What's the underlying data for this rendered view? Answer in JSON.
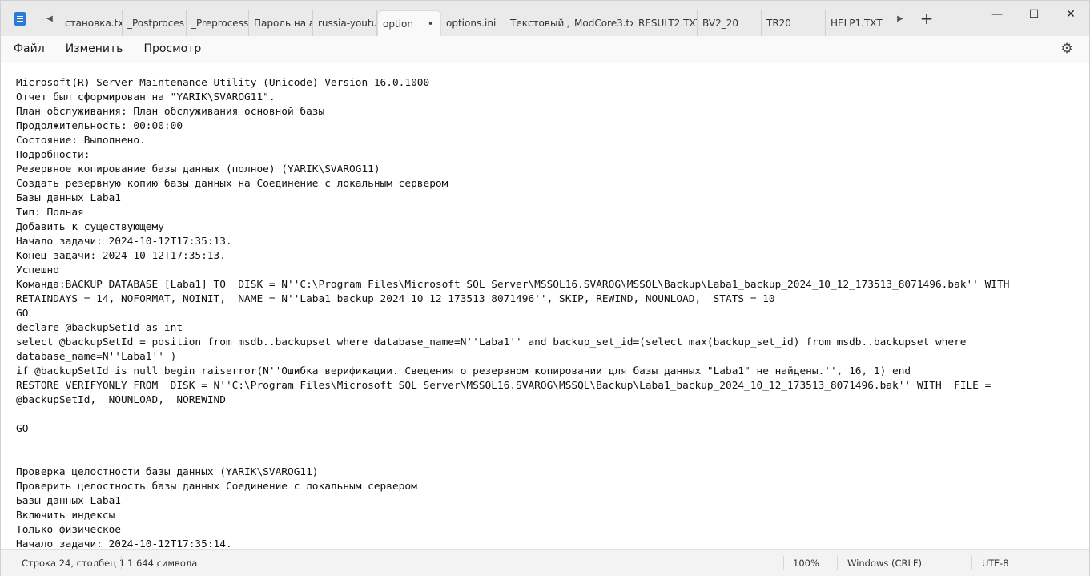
{
  "tabs": {
    "items": [
      {
        "label": "становка.tx"
      },
      {
        "label": "_Postproces"
      },
      {
        "label": "_Preprocess"
      },
      {
        "label": "Пароль на а"
      },
      {
        "label": "russia-youtu"
      },
      {
        "label": "option",
        "active": true,
        "modified_marker": "•"
      },
      {
        "label": "options.ini"
      },
      {
        "label": "Текстовый д"
      },
      {
        "label": "ModCore3.tx"
      },
      {
        "label": "RESULT2.TXT"
      },
      {
        "label": "BV2_20"
      },
      {
        "label": "TR20"
      },
      {
        "label": "HELP1.TXT"
      }
    ],
    "scroll_left": "◀",
    "scroll_right": "▶",
    "new_tab": "+"
  },
  "window_controls": {
    "minimize": "—",
    "maximize": "☐",
    "close": "✕"
  },
  "menu": {
    "file": "Файл",
    "edit": "Изменить",
    "view": "Просмотр",
    "settings_icon": "⚙"
  },
  "document": {
    "lines": [
      "Microsoft(R) Server Maintenance Utility (Unicode) Version 16.0.1000",
      "Отчет был сформирован на \"YARIK\\SVAROG11\".",
      "План обслуживания: План обслуживания основной базы",
      "Продолжительность: 00:00:00",
      "Состояние: Выполнено.",
      "Подробности:",
      "Резервное копирование базы данных (полное) (YARIK\\SVAROG11)",
      "Создать резервную копию базы данных на Соединение с локальным сервером",
      "Базы данных Laba1",
      "Тип: Полная",
      "Добавить к существующему",
      "Начало задачи: 2024-10-12T17:35:13.",
      "Конец задачи: 2024-10-12T17:35:13.",
      "Успешно",
      "Команда:BACKUP DATABASE [Laba1] TO  DISK = N''C:\\Program Files\\Microsoft SQL Server\\MSSQL16.SVAROG\\MSSQL\\Backup\\Laba1_backup_2024_10_12_173513_8071496.bak'' WITH",
      "RETAINDAYS = 14, NOFORMAT, NOINIT,  NAME = N''Laba1_backup_2024_10_12_173513_8071496'', SKIP, REWIND, NOUNLOAD,  STATS = 10",
      "GO",
      "declare @backupSetId as int",
      "select @backupSetId = position from msdb..backupset where database_name=N''Laba1'' and backup_set_id=(select max(backup_set_id) from msdb..backupset where",
      "database_name=N''Laba1'' )",
      "if @backupSetId is null begin raiserror(N''Ошибка верификации. Сведения о резервном копировании для базы данных \"Laba1\" не найдены.'', 16, 1) end",
      "RESTORE VERIFYONLY FROM  DISK = N''C:\\Program Files\\Microsoft SQL Server\\MSSQL16.SVAROG\\MSSQL\\Backup\\Laba1_backup_2024_10_12_173513_8071496.bak'' WITH  FILE =",
      "@backupSetId,  NOUNLOAD,  NOREWIND",
      "",
      "GO",
      "",
      "",
      "Проверка целостности базы данных (YARIK\\SVAROG11)",
      "Проверить целостность базы данных Соединение с локальным сервером",
      "Базы данных Laba1",
      "Включить индексы",
      "Только физическое",
      "Начало задачи: 2024-10-12T17:35:14."
    ]
  },
  "status": {
    "position": "Строка 24, столбец 1",
    "char_count": "1 644 символа",
    "zoom": "100%",
    "line_ending": "Windows (CRLF)",
    "encoding": "UTF-8"
  }
}
